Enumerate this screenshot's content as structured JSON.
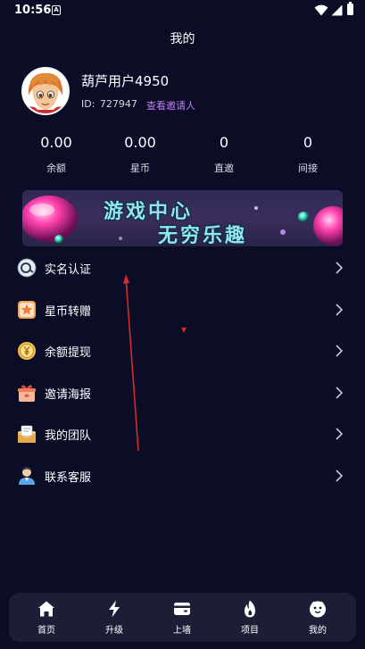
{
  "status_bar": {
    "time": "10:56",
    "notification_icon": "A"
  },
  "header": {
    "title": "我的"
  },
  "profile": {
    "username": "葫芦用户4950",
    "id_label": "ID:",
    "id_value": "727947",
    "inviter_link": "查看邀请人"
  },
  "stats": [
    {
      "value": "0.00",
      "label": "余额"
    },
    {
      "value": "0.00",
      "label": "星币"
    },
    {
      "value": "0",
      "label": "直邀"
    },
    {
      "value": "0",
      "label": "间接"
    }
  ],
  "banner": {
    "line1": "游戏中心",
    "line2": "无穷乐趣"
  },
  "menu": [
    {
      "label": "实名认证",
      "icon": "id-verify-icon"
    },
    {
      "label": "星币转赠",
      "icon": "star-coin-icon"
    },
    {
      "label": "余额提现",
      "icon": "yuan-coin-icon"
    },
    {
      "label": "邀请海报",
      "icon": "gift-icon"
    },
    {
      "label": "我的团队",
      "icon": "team-envelope-icon"
    },
    {
      "label": "联系客服",
      "icon": "customer-service-icon"
    }
  ],
  "bottom_nav": [
    {
      "label": "首页",
      "icon": "home-icon"
    },
    {
      "label": "升级",
      "icon": "lightning-icon"
    },
    {
      "label": "上墙",
      "icon": "wallet-icon"
    },
    {
      "label": "项目",
      "icon": "flame-icon"
    },
    {
      "label": "我的",
      "icon": "face-icon"
    }
  ],
  "colors": {
    "background": "#0b0d27",
    "accent_link": "#c37ef0",
    "nav_background": "#1c1e38",
    "annotation_red": "#d42a2a"
  }
}
